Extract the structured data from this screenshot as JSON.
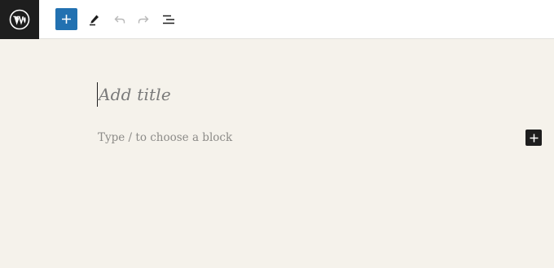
{
  "toolbar": {
    "logo_icon": "wordpress-logo-icon",
    "add_block_icon": "plus-icon",
    "tools_icon": "pencil-icon",
    "undo_icon": "undo-icon",
    "redo_icon": "redo-icon",
    "list_view_icon": "list-view-icon",
    "accent_color": "#2271b1",
    "logo_background": "#1e1e1e"
  },
  "editor": {
    "title_placeholder": "Add title",
    "block_placeholder": "Type / to choose a block",
    "inserter_icon": "plus-icon",
    "canvas_background": "#f5f2eb"
  }
}
